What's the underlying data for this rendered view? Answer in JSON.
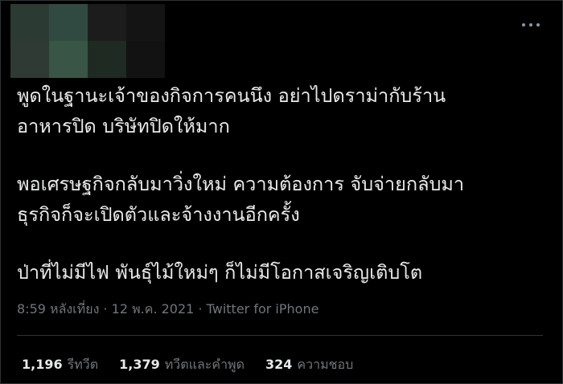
{
  "tweet": {
    "avatar_pixels": [
      "#2b3b33",
      "#314a41",
      "#1c1c1c",
      "#2e3a33",
      "#385545",
      "#1f2a22",
      "#121212",
      "#141414"
    ],
    "paragraphs": [
      [
        "พูดในฐานะเจ้าของกิจการคนนึง อย่าไปดราม่ากับร้าน",
        "อาหารปิด บริษัทปิดให้มาก"
      ],
      [
        "พอเศรษฐกิจกลับมาวิ่งใหม่ ความต้องการ จับจ่ายกลับมา",
        "ธุรกิจก็จะเปิดตัวและจ้างงานอีกครั้ง"
      ],
      [
        "ป่าที่ไม่มีไฟ พันธุ์ไม้ใหม่ๆ ก็ไม่มีโอกาสเจริญเติบโต"
      ]
    ],
    "time": "8:59 หลังเที่ยง",
    "separator": "·",
    "date": "12 พ.ค. 2021",
    "source": "Twitter for iPhone"
  },
  "stats": {
    "retweets": {
      "count": "1,196",
      "label": "รีทวีต"
    },
    "quotes": {
      "count": "1,379",
      "label": "ทวีตและคำพูด"
    },
    "likes": {
      "count": "324",
      "label": "ความชอบ"
    }
  }
}
